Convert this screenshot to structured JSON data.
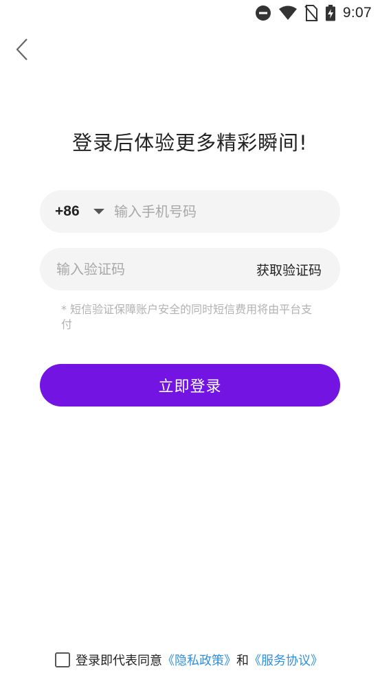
{
  "status_bar": {
    "time": "9:07",
    "icons": [
      "do-not-disturb-icon",
      "wifi-icon",
      "no-sim-icon",
      "battery-charging-icon"
    ]
  },
  "nav": {
    "back_icon": "chevron-left-icon"
  },
  "headline": "登录后体验更多精彩瞬间!",
  "phone": {
    "country_code": "+86",
    "placeholder": "输入手机号码",
    "value": ""
  },
  "code": {
    "placeholder": "输入验证码",
    "value": "",
    "get_code_label": "获取验证码"
  },
  "sms_note": "* 短信验证保障账户安全的同时短信费用将由平台支付",
  "login_button": "立即登录",
  "agreement": {
    "checked": false,
    "prefix": "登录即代表同意",
    "privacy_link": "《隐私政策》",
    "and": "和",
    "terms_link": "《服务协议》"
  },
  "colors": {
    "primary": "#7414e2",
    "link": "#2f8fe0",
    "field_bg": "#f4f4f4",
    "placeholder": "#a8a8a8"
  }
}
